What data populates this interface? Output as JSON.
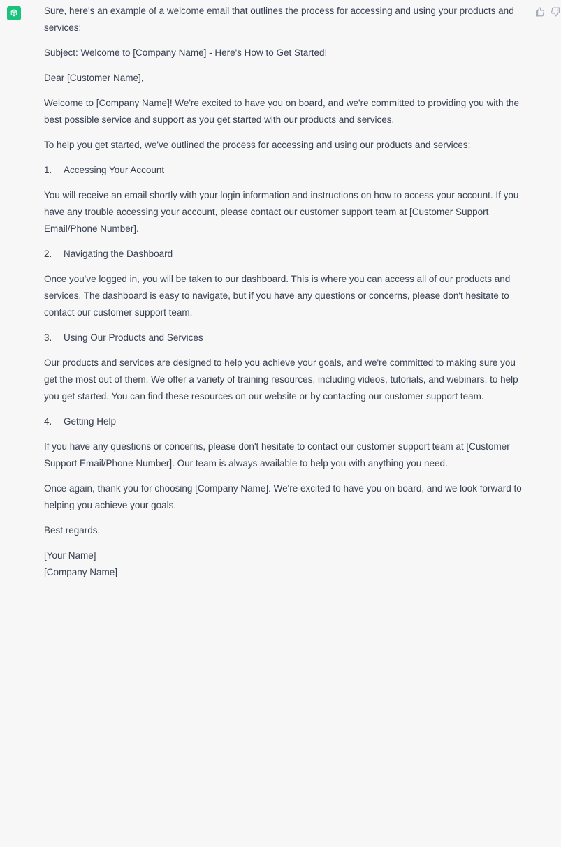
{
  "assistant": {
    "avatar_icon": "openai-logo-icon",
    "accent_color": "#19c37d"
  },
  "feedback": {
    "thumbs_up_icon": "thumbs-up-icon",
    "thumbs_down_icon": "thumbs-down-icon"
  },
  "message": {
    "intro": "Sure, here's an example of a welcome email that outlines the process for accessing and using your products and services:",
    "subject": "Subject: Welcome to [Company Name] - Here's How to Get Started!",
    "greeting": "Dear [Customer Name],",
    "welcome_paragraph": "Welcome to [Company Name]! We're excited to have you on board, and we're committed to providing you with the best possible service and support as you get started with our products and services.",
    "outline_paragraph": "To help you get started, we've outlined the process for accessing and using our products and services:",
    "steps": [
      {
        "number": "1.",
        "title": "Accessing Your Account",
        "body": "You will receive an email shortly with your login information and instructions on how to access your account. If you have any trouble accessing your account, please contact our customer support team at [Customer Support Email/Phone Number]."
      },
      {
        "number": "2.",
        "title": "Navigating the Dashboard",
        "body": "Once you've logged in, you will be taken to our dashboard. This is where you can access all of our products and services. The dashboard is easy to navigate, but if you have any questions or concerns, please don't hesitate to contact our customer support team."
      },
      {
        "number": "3.",
        "title": "Using Our Products and Services",
        "body": "Our products and services are designed to help you achieve your goals, and we're committed to making sure you get the most out of them. We offer a variety of training resources, including videos, tutorials, and webinars, to help you get started. You can find these resources on our website or by contacting our customer support team."
      },
      {
        "number": "4.",
        "title": "Getting Help",
        "body": "If you have any questions or concerns, please don't hesitate to contact our customer support team at [Customer Support Email/Phone Number]. Our team is always available to help you with anything you need."
      }
    ],
    "closing_paragraph": "Once again, thank you for choosing [Company Name]. We're excited to have you on board, and we look forward to helping you achieve your goals.",
    "sign_off": "Best regards,",
    "signature_name": "[Your Name]",
    "signature_company": "[Company Name]"
  }
}
